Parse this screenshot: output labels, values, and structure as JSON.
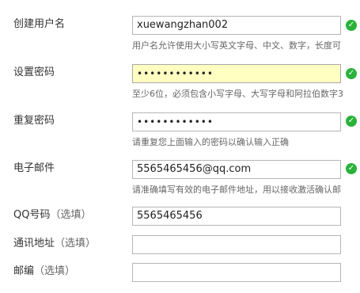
{
  "form": {
    "fields": [
      {
        "label": "创建用户名",
        "optional": "",
        "value": "xuewangzhan002",
        "valid": true,
        "hint": "用户名允许使用大小写英文字母、中文、数字，长度可"
      },
      {
        "label": "设置密码",
        "optional": "",
        "value": "••••••••••••",
        "valid": true,
        "hint": "至少6位，必须包含小写字母、大写字母和阿拉伯数字3"
      },
      {
        "label": "重复密码",
        "optional": "",
        "value": "••••••••••••",
        "valid": true,
        "hint": "请重复您上面输入的密码以确认输入正确"
      },
      {
        "label": "电子邮件",
        "optional": "",
        "value": "5565465456@qq.com",
        "valid": true,
        "hint": "请准确填写有效的电子邮件地址，用以接收激活确认邮"
      },
      {
        "label": "QQ号码",
        "optional": "（选填）",
        "value": "5565465456",
        "valid": false,
        "hint": ""
      },
      {
        "label": "通讯地址",
        "optional": "（选填）",
        "value": "",
        "valid": false,
        "hint": ""
      },
      {
        "label": "邮编",
        "optional": "（选填）",
        "value": "",
        "valid": false,
        "hint": ""
      }
    ],
    "check_icon": "check-circle-icon",
    "check_color": "#2ab23a",
    "focus_background": "#ffffc2"
  }
}
